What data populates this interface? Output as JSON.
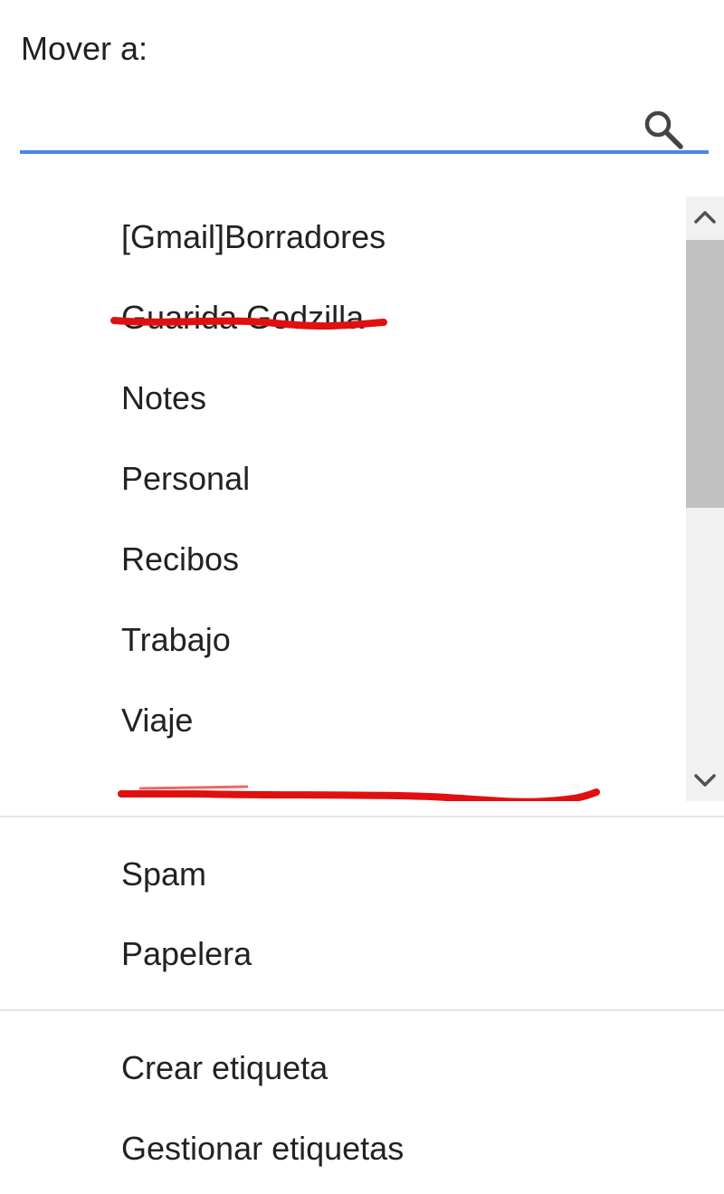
{
  "header": {
    "label": "Mover a:"
  },
  "search": {
    "value": "",
    "placeholder": "",
    "icon": "search-icon"
  },
  "labels_list": {
    "items": [
      {
        "label": "[Gmail]Borradores",
        "redacted": false
      },
      {
        "label": "Guarida Godzilla",
        "redacted": true
      },
      {
        "label": "Notes",
        "redacted": false
      },
      {
        "label": "Personal",
        "redacted": false
      },
      {
        "label": "Recibos",
        "redacted": false
      },
      {
        "label": "Trabajo",
        "redacted": false
      },
      {
        "label": "Viaje",
        "redacted": false
      },
      {
        "label": "",
        "redacted": true
      }
    ],
    "redaction_color": "#e01010"
  },
  "system_folders": {
    "items": [
      {
        "label": "Spam"
      },
      {
        "label": "Papelera"
      }
    ]
  },
  "actions": {
    "items": [
      {
        "label": "Crear etiqueta"
      },
      {
        "label": "Gestionar etiquetas"
      }
    ]
  },
  "colors": {
    "accent_underline": "#4a86e8",
    "scroll_track": "#f1f1f1",
    "scroll_thumb": "#c1c1c1"
  }
}
